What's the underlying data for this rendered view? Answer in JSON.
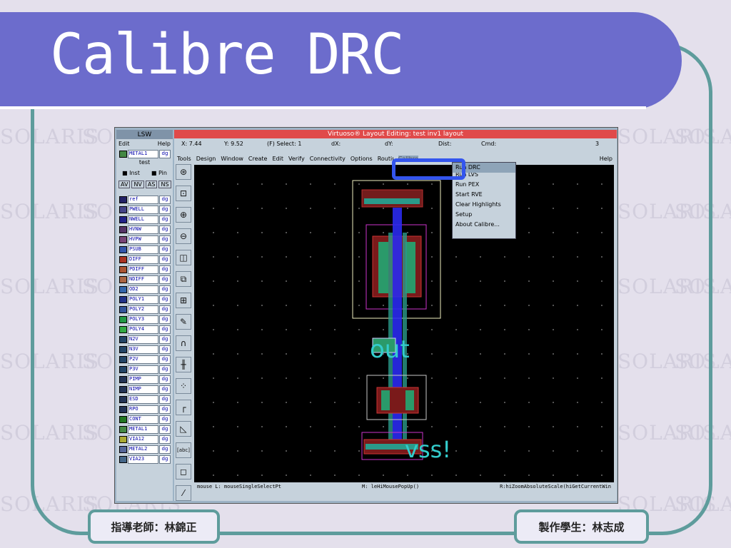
{
  "slide": {
    "title": "Calibre DRC",
    "advisor": "指導老師：林錦正",
    "student": "製作學生：林志成",
    "background_watermark": "SOLARIS"
  },
  "lsw": {
    "title": "LSW",
    "menu_edit": "Edit",
    "menu_help": "Help",
    "current_layer": "METAL1",
    "current_purpose": "dg",
    "library": "test",
    "inst_label": "Inst",
    "pin_label": "Pin",
    "buttons": [
      "AV",
      "NV",
      "AS",
      "NS"
    ],
    "layers": [
      {
        "name": "ref",
        "purpose": "dg",
        "color": "#222266"
      },
      {
        "name": "PWELL",
        "purpose": "dg",
        "color": "#444488"
      },
      {
        "name": "NWELL",
        "purpose": "dg",
        "color": "#222288"
      },
      {
        "name": "HVNW",
        "purpose": "dg",
        "color": "#553366"
      },
      {
        "name": "HVPW",
        "purpose": "dg",
        "color": "#774477"
      },
      {
        "name": "PSUB",
        "purpose": "dg",
        "color": "#3355aa"
      },
      {
        "name": "DIFF",
        "purpose": "dg",
        "color": "#aa3322"
      },
      {
        "name": "PDIFF",
        "purpose": "dg",
        "color": "#aa5533"
      },
      {
        "name": "NDIFF",
        "purpose": "dg",
        "color": "#aa6644"
      },
      {
        "name": "OD2",
        "purpose": "dg",
        "color": "#3366aa"
      },
      {
        "name": "POLY1",
        "purpose": "dg",
        "color": "#223388"
      },
      {
        "name": "POLY2",
        "purpose": "dg",
        "color": "#335599"
      },
      {
        "name": "POLY3",
        "purpose": "dg",
        "color": "#229944"
      },
      {
        "name": "POLY4",
        "purpose": "dg",
        "color": "#33aa44"
      },
      {
        "name": "N2V",
        "purpose": "dg",
        "color": "#224466"
      },
      {
        "name": "N3V",
        "purpose": "dg",
        "color": "#224466"
      },
      {
        "name": "P2V",
        "purpose": "dg",
        "color": "#224466"
      },
      {
        "name": "P3V",
        "purpose": "dg",
        "color": "#224466"
      },
      {
        "name": "PIMP",
        "purpose": "dg",
        "color": "#223355"
      },
      {
        "name": "NIMP",
        "purpose": "dg",
        "color": "#223355"
      },
      {
        "name": "ESD",
        "purpose": "dg",
        "color": "#223355"
      },
      {
        "name": "RPO",
        "purpose": "dg",
        "color": "#223355"
      },
      {
        "name": "CONT",
        "purpose": "dg",
        "color": "#227722"
      },
      {
        "name": "METAL1",
        "purpose": "dg",
        "color": "#448844"
      },
      {
        "name": "VIA12",
        "purpose": "dg",
        "color": "#aaaa33"
      },
      {
        "name": "METAL2",
        "purpose": "dg",
        "color": "#556699"
      },
      {
        "name": "VIA23",
        "purpose": "dg",
        "color": "#446688"
      }
    ]
  },
  "virtuoso": {
    "title": "Virtuoso® Layout Editing: test inv1 layout",
    "x_label": "X:",
    "x_value": "7.44",
    "y_label": "Y:",
    "y_value": "9.52",
    "select_label": "(F) Select:",
    "select_value": "1",
    "dx_label": "dX:",
    "dy_label": "dY:",
    "dist_label": "Dist:",
    "cmd_label": "Cmd:",
    "count": "3",
    "menu": [
      "Tools",
      "Design",
      "Window",
      "Create",
      "Edit",
      "Verify",
      "Connectivity",
      "Options",
      "Routing",
      "Calibre"
    ],
    "help": "Help",
    "dropdown": [
      "Run DRC",
      "Run LVS",
      "Run PEX",
      "Start RVE",
      "Clear Highlights",
      "Setup",
      "About Calibre..."
    ],
    "status_left": "mouse L: mouseSingleSelectPt",
    "status_mid": "M: leHiMousePopUp()",
    "status_right": "R:hiZoomAbsoluteScale(hiGetCurrentWin",
    "labels": {
      "out": "out",
      "vss": "vss!"
    }
  },
  "colors": {
    "banner": "#6c6ccc",
    "frame": "#5e9c9c",
    "highlight": "#3355ee"
  }
}
